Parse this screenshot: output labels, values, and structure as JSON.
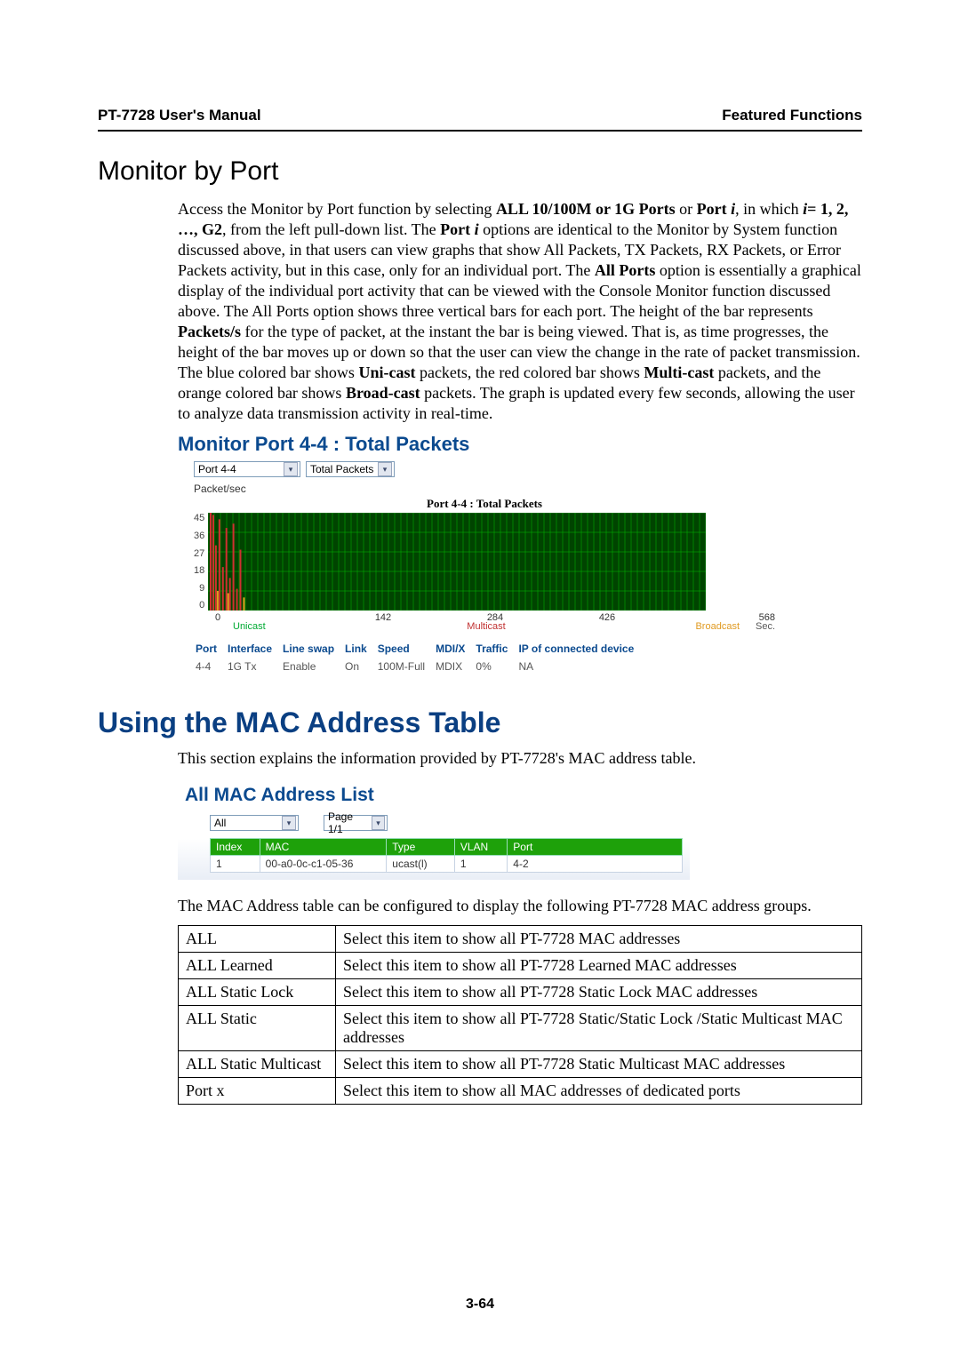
{
  "header": {
    "left": "PT-7728 User's Manual",
    "right": "Featured Functions"
  },
  "section1": {
    "title": "Monitor by Port",
    "para_parts": [
      {
        "t": "Access the Monitor by Port function by selecting "
      },
      {
        "t": "ALL 10/100M or 1G Ports",
        "b": true
      },
      {
        "t": " or "
      },
      {
        "t": "Port ",
        "b": true
      },
      {
        "t": "i",
        "b": true,
        "i": true
      },
      {
        "t": ", in which "
      },
      {
        "t": "i",
        "b": true,
        "i": true
      },
      {
        "t": "= 1, 2, …, G2",
        "b": true
      },
      {
        "t": ", from the left pull-down list. The "
      },
      {
        "t": "Port ",
        "b": true
      },
      {
        "t": "i",
        "b": true,
        "i": true
      },
      {
        "t": " options are identical to the Monitor by System function discussed above, in that users can view graphs that show All Packets, TX Packets, RX Packets, or Error Packets activity, but in this case, only for an individual port. The "
      },
      {
        "t": "All Ports",
        "b": true
      },
      {
        "t": " option is essentially a graphical display of the individual port activity that can be viewed with the Console Monitor function discussed above. The All Ports option shows three vertical bars for each port. The height of the bar represents "
      },
      {
        "t": "Packets/s",
        "b": true
      },
      {
        "t": " for the type of packet, at the instant the bar is being viewed. That is, as time progresses, the height of the bar moves up or down so that the user can view the change in the rate of packet transmission. The blue colored bar shows "
      },
      {
        "t": "Uni-cast",
        "b": true
      },
      {
        "t": " packets, the red colored bar shows "
      },
      {
        "t": "Multi-cast",
        "b": true
      },
      {
        "t": " packets, and the orange colored bar shows "
      },
      {
        "t": "Broad-cast",
        "b": true
      },
      {
        "t": " packets. The graph is updated every few seconds, allowing the user to analyze data transmission activity in real-time."
      }
    ]
  },
  "monitor_panel": {
    "title": "Monitor Port 4-4 : Total Packets",
    "port_select": "Port 4-4",
    "metric_select": "Total Packets",
    "ylabel": "Packet/sec",
    "chart_label": "Port 4-4 : Total Packets",
    "legend": {
      "unicast": "Unicast",
      "multicast": "Multicast",
      "broadcast": "Broadcast",
      "sec": "Sec."
    },
    "info_headers": [
      "Port",
      "Interface",
      "Line swap",
      "Link",
      "Speed",
      "MDI/X",
      "Traffic",
      "IP of connected device"
    ],
    "info_values": [
      "4-4",
      "1G Tx",
      "Enable",
      "On",
      "100M-Full",
      "MDIX",
      "0%",
      "NA"
    ]
  },
  "chart_data": {
    "type": "bar",
    "title": "Port 4-4 : Total Packets",
    "xlabel": "Sec.",
    "ylabel": "Packet/sec",
    "xlim": [
      0,
      568
    ],
    "ylim": [
      0,
      45
    ],
    "yticks": [
      45,
      36,
      27,
      18,
      9,
      0
    ],
    "xticks": [
      0,
      142,
      284,
      426,
      568
    ],
    "legend": [
      "Unicast",
      "Multicast",
      "Broadcast"
    ],
    "note": "Dense per-second bar chart; early seconds (~0–40) show Multicast spikes up to ~45 pkt/s with occasional Broadcast ~10 pkt/s; Unicast ~0 throughout; remainder of 0–568 s near 0.",
    "series": [
      {
        "name": "Unicast",
        "color": "blue",
        "values_summary": "≈0 for all x"
      },
      {
        "name": "Multicast",
        "color": "red",
        "sample_spikes": [
          {
            "x": 2,
            "y": 45
          },
          {
            "x": 5,
            "y": 44
          },
          {
            "x": 8,
            "y": 30
          },
          {
            "x": 12,
            "y": 42
          },
          {
            "x": 16,
            "y": 20
          },
          {
            "x": 20,
            "y": 38
          },
          {
            "x": 24,
            "y": 15
          },
          {
            "x": 28,
            "y": 40
          },
          {
            "x": 32,
            "y": 10
          },
          {
            "x": 36,
            "y": 28
          }
        ]
      },
      {
        "name": "Broadcast",
        "color": "orange",
        "sample_spikes": [
          {
            "x": 10,
            "y": 9
          },
          {
            "x": 22,
            "y": 8
          },
          {
            "x": 40,
            "y": 6
          }
        ]
      }
    ]
  },
  "section2": {
    "title": "Using the MAC Address Table",
    "intro": "This section explains the information provided by PT-7728's MAC address table."
  },
  "mac_panel": {
    "title": "All MAC Address List",
    "filter_select": "All",
    "page_select": "Page 1/1",
    "columns": [
      "Index",
      "MAC",
      "Type",
      "VLAN",
      "Port"
    ],
    "rows": [
      {
        "Index": "1",
        "MAC": "00-a0-0c-c1-05-36",
        "Type": "ucast(l)",
        "VLAN": "1",
        "Port": "4-2"
      }
    ]
  },
  "desc_intro": "The MAC Address table can be configured to display the following PT-7728 MAC address groups.",
  "desc_table": [
    {
      "k": "ALL",
      "v": "Select this item to show all PT-7728 MAC addresses"
    },
    {
      "k": "ALL Learned",
      "v": "Select this item to show all PT-7728 Learned MAC addresses"
    },
    {
      "k": "ALL Static Lock",
      "v": "Select this item to show all PT-7728 Static Lock MAC addresses"
    },
    {
      "k": "ALL Static",
      "v": "Select this item to show all PT-7728 Static/Static Lock /Static Multicast MAC addresses"
    },
    {
      "k": "ALL Static Multicast",
      "v": "Select this item to show all PT-7728 Static Multicast MAC addresses"
    },
    {
      "k": "Port x",
      "v": "Select this item to show all MAC addresses of dedicated ports"
    }
  ],
  "page_number": "3-64"
}
